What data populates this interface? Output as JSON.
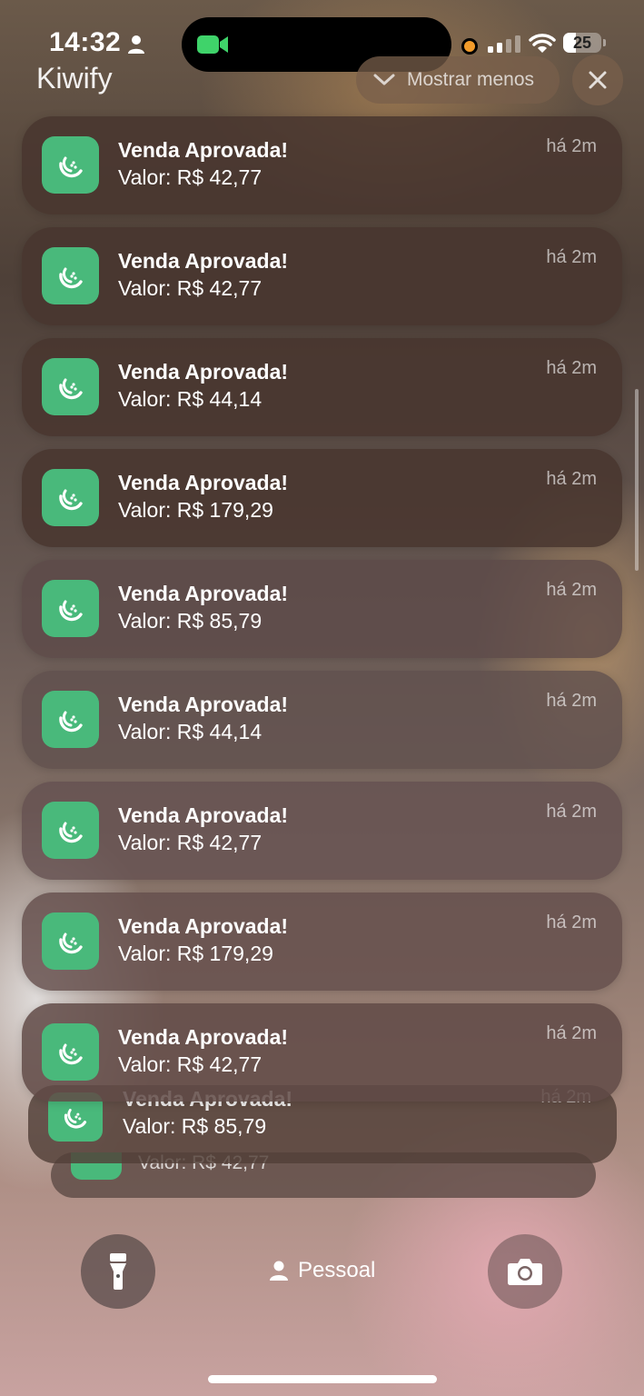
{
  "status_bar": {
    "time": "14:32",
    "battery_level": "25",
    "icons": [
      "person-icon",
      "facetime-camera-icon",
      "orange-dot-icon",
      "cellular-signal-icon",
      "wifi-icon",
      "battery-icon"
    ]
  },
  "header": {
    "app_name": "Kiwify",
    "show_less_label": "Mostrar menos",
    "close_icon": "close-icon"
  },
  "colors": {
    "app_icon_green": "#49b97b",
    "card_background": "#48362e"
  },
  "notifications": [
    {
      "title": "Venda Aprovada!",
      "body": "Valor: R$ 42,77",
      "time": "há 2m"
    },
    {
      "title": "Venda Aprovada!",
      "body": "Valor: R$ 42,77",
      "time": "há 2m"
    },
    {
      "title": "Venda Aprovada!",
      "body": "Valor: R$ 44,14",
      "time": "há 2m"
    },
    {
      "title": "Venda Aprovada!",
      "body": "Valor: R$ 179,29",
      "time": "há 2m"
    },
    {
      "title": "Venda Aprovada!",
      "body": "Valor: R$ 85,79",
      "time": "há 2m"
    },
    {
      "title": "Venda Aprovada!",
      "body": "Valor: R$ 44,14",
      "time": "há 2m"
    },
    {
      "title": "Venda Aprovada!",
      "body": "Valor: R$ 42,77",
      "time": "há 2m"
    },
    {
      "title": "Venda Aprovada!",
      "body": "Valor: R$ 179,29",
      "time": "há 2m"
    },
    {
      "title": "Venda Aprovada!",
      "body": "Valor: R$ 42,77",
      "time": "há 2m"
    }
  ],
  "stacked": [
    {
      "title": "Venda Aprovada!",
      "body": "Valor: R$ 85,79",
      "time": "há 2m"
    },
    {
      "body": "Valor: R$ 42,77"
    }
  ],
  "bottom_bar": {
    "flashlight_icon": "flashlight-icon",
    "focus_label": "Pessoal",
    "camera_icon": "camera-icon"
  }
}
